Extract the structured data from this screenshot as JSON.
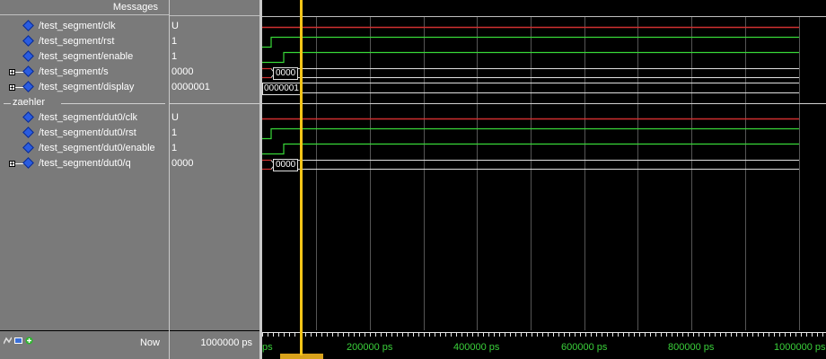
{
  "header": {
    "messages_label": "Messages"
  },
  "signals": [
    {
      "name": "/test_segment/clk",
      "value": "U",
      "expandable": false
    },
    {
      "name": "/test_segment/rst",
      "value": "1",
      "expandable": false
    },
    {
      "name": "/test_segment/enable",
      "value": "1",
      "expandable": false
    },
    {
      "name": "/test_segment/s",
      "value": "0000",
      "expandable": true
    },
    {
      "name": "/test_segment/display",
      "value": "0000001",
      "expandable": true
    },
    {
      "name": "/test_segment/dut0/clk",
      "value": "U",
      "expandable": false
    },
    {
      "name": "/test_segment/dut0/rst",
      "value": "1",
      "expandable": false
    },
    {
      "name": "/test_segment/dut0/enable",
      "value": "1",
      "expandable": false
    },
    {
      "name": "/test_segment/dut0/q",
      "value": "0000",
      "expandable": true
    }
  ],
  "group_label": "zaehler",
  "bus_labels": {
    "s": "0000",
    "display": "0000001",
    "q": "0000"
  },
  "footer": {
    "now_label": "Now",
    "now_value": "1000000 ps"
  },
  "timeline": {
    "ticks": [
      "ps",
      "200000 ps",
      "400000 ps",
      "600000 ps",
      "800000 ps",
      "1000000 ps"
    ]
  },
  "colors": {
    "panel_bg": "#7a7a7a",
    "wave_bg": "#000000",
    "signal_high": "#38d838",
    "signal_unknown": "#d03030",
    "bus_line": "#e0e0e0",
    "cursor": "#f5c518",
    "time_label": "#3ad13a"
  }
}
